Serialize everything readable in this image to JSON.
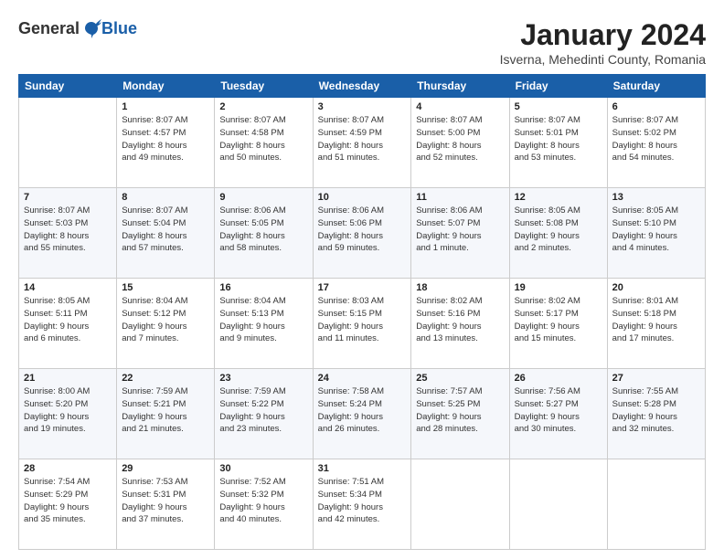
{
  "logo": {
    "general": "General",
    "blue": "Blue"
  },
  "title": "January 2024",
  "location": "Isverna, Mehedinti County, Romania",
  "days_of_week": [
    "Sunday",
    "Monday",
    "Tuesday",
    "Wednesday",
    "Thursday",
    "Friday",
    "Saturday"
  ],
  "weeks": [
    [
      {
        "day": "",
        "info": ""
      },
      {
        "day": "1",
        "info": "Sunrise: 8:07 AM\nSunset: 4:57 PM\nDaylight: 8 hours\nand 49 minutes."
      },
      {
        "day": "2",
        "info": "Sunrise: 8:07 AM\nSunset: 4:58 PM\nDaylight: 8 hours\nand 50 minutes."
      },
      {
        "day": "3",
        "info": "Sunrise: 8:07 AM\nSunset: 4:59 PM\nDaylight: 8 hours\nand 51 minutes."
      },
      {
        "day": "4",
        "info": "Sunrise: 8:07 AM\nSunset: 5:00 PM\nDaylight: 8 hours\nand 52 minutes."
      },
      {
        "day": "5",
        "info": "Sunrise: 8:07 AM\nSunset: 5:01 PM\nDaylight: 8 hours\nand 53 minutes."
      },
      {
        "day": "6",
        "info": "Sunrise: 8:07 AM\nSunset: 5:02 PM\nDaylight: 8 hours\nand 54 minutes."
      }
    ],
    [
      {
        "day": "7",
        "info": "Sunrise: 8:07 AM\nSunset: 5:03 PM\nDaylight: 8 hours\nand 55 minutes."
      },
      {
        "day": "8",
        "info": "Sunrise: 8:07 AM\nSunset: 5:04 PM\nDaylight: 8 hours\nand 57 minutes."
      },
      {
        "day": "9",
        "info": "Sunrise: 8:06 AM\nSunset: 5:05 PM\nDaylight: 8 hours\nand 58 minutes."
      },
      {
        "day": "10",
        "info": "Sunrise: 8:06 AM\nSunset: 5:06 PM\nDaylight: 8 hours\nand 59 minutes."
      },
      {
        "day": "11",
        "info": "Sunrise: 8:06 AM\nSunset: 5:07 PM\nDaylight: 9 hours\nand 1 minute."
      },
      {
        "day": "12",
        "info": "Sunrise: 8:05 AM\nSunset: 5:08 PM\nDaylight: 9 hours\nand 2 minutes."
      },
      {
        "day": "13",
        "info": "Sunrise: 8:05 AM\nSunset: 5:10 PM\nDaylight: 9 hours\nand 4 minutes."
      }
    ],
    [
      {
        "day": "14",
        "info": "Sunrise: 8:05 AM\nSunset: 5:11 PM\nDaylight: 9 hours\nand 6 minutes."
      },
      {
        "day": "15",
        "info": "Sunrise: 8:04 AM\nSunset: 5:12 PM\nDaylight: 9 hours\nand 7 minutes."
      },
      {
        "day": "16",
        "info": "Sunrise: 8:04 AM\nSunset: 5:13 PM\nDaylight: 9 hours\nand 9 minutes."
      },
      {
        "day": "17",
        "info": "Sunrise: 8:03 AM\nSunset: 5:15 PM\nDaylight: 9 hours\nand 11 minutes."
      },
      {
        "day": "18",
        "info": "Sunrise: 8:02 AM\nSunset: 5:16 PM\nDaylight: 9 hours\nand 13 minutes."
      },
      {
        "day": "19",
        "info": "Sunrise: 8:02 AM\nSunset: 5:17 PM\nDaylight: 9 hours\nand 15 minutes."
      },
      {
        "day": "20",
        "info": "Sunrise: 8:01 AM\nSunset: 5:18 PM\nDaylight: 9 hours\nand 17 minutes."
      }
    ],
    [
      {
        "day": "21",
        "info": "Sunrise: 8:00 AM\nSunset: 5:20 PM\nDaylight: 9 hours\nand 19 minutes."
      },
      {
        "day": "22",
        "info": "Sunrise: 7:59 AM\nSunset: 5:21 PM\nDaylight: 9 hours\nand 21 minutes."
      },
      {
        "day": "23",
        "info": "Sunrise: 7:59 AM\nSunset: 5:22 PM\nDaylight: 9 hours\nand 23 minutes."
      },
      {
        "day": "24",
        "info": "Sunrise: 7:58 AM\nSunset: 5:24 PM\nDaylight: 9 hours\nand 26 minutes."
      },
      {
        "day": "25",
        "info": "Sunrise: 7:57 AM\nSunset: 5:25 PM\nDaylight: 9 hours\nand 28 minutes."
      },
      {
        "day": "26",
        "info": "Sunrise: 7:56 AM\nSunset: 5:27 PM\nDaylight: 9 hours\nand 30 minutes."
      },
      {
        "day": "27",
        "info": "Sunrise: 7:55 AM\nSunset: 5:28 PM\nDaylight: 9 hours\nand 32 minutes."
      }
    ],
    [
      {
        "day": "28",
        "info": "Sunrise: 7:54 AM\nSunset: 5:29 PM\nDaylight: 9 hours\nand 35 minutes."
      },
      {
        "day": "29",
        "info": "Sunrise: 7:53 AM\nSunset: 5:31 PM\nDaylight: 9 hours\nand 37 minutes."
      },
      {
        "day": "30",
        "info": "Sunrise: 7:52 AM\nSunset: 5:32 PM\nDaylight: 9 hours\nand 40 minutes."
      },
      {
        "day": "31",
        "info": "Sunrise: 7:51 AM\nSunset: 5:34 PM\nDaylight: 9 hours\nand 42 minutes."
      },
      {
        "day": "",
        "info": ""
      },
      {
        "day": "",
        "info": ""
      },
      {
        "day": "",
        "info": ""
      }
    ]
  ]
}
